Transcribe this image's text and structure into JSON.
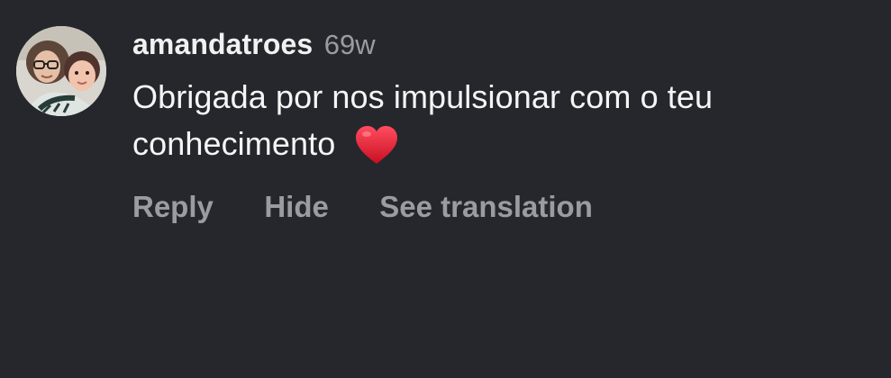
{
  "comment": {
    "username": "amandatroes",
    "timestamp": "69w",
    "text": "Obrigada por nos impulsionar com o teu conhecimento",
    "emoji": "heart-emoji"
  },
  "actions": {
    "reply": "Reply",
    "hide": "Hide",
    "see_translation": "See translation"
  },
  "colors": {
    "background": "#25272c",
    "username": "#f1f1f2",
    "secondary": "#9a9ca1",
    "heart": "#e0182b"
  },
  "icons": {
    "avatar": "profile-photo",
    "emoji": "red-heart"
  }
}
